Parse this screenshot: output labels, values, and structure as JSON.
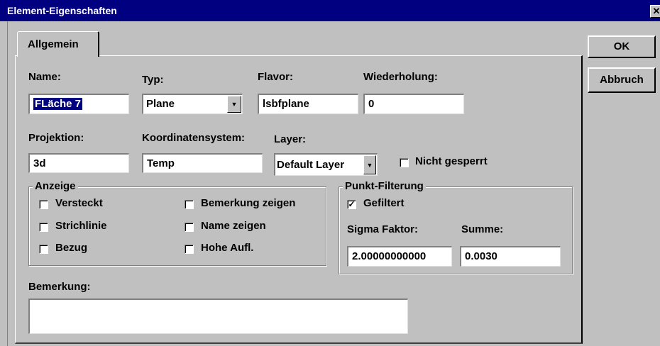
{
  "window": {
    "title": "Element-Eigenschaften",
    "close_glyph": "✕"
  },
  "tabs": [
    {
      "label": "Allgemein"
    }
  ],
  "buttons": {
    "ok": "OK",
    "cancel": "Abbruch"
  },
  "fields": {
    "name": {
      "label": "Name:",
      "value": "FLäche 7"
    },
    "typ": {
      "label": "Typ:",
      "value": "Plane"
    },
    "flavor": {
      "label": "Flavor:",
      "value": "lsbfplane"
    },
    "wiederholung": {
      "label": "Wiederholung:",
      "value": "0"
    },
    "projektion": {
      "label": "Projektion:",
      "value": "3d"
    },
    "koordinatensystem": {
      "label": "Koordinatensystem:",
      "value": "Temp"
    },
    "layer": {
      "label": "Layer:",
      "value": "Default Layer"
    },
    "nicht_gesperrt": {
      "label": "Nicht gesperrt",
      "checked": false
    },
    "bemerkung": {
      "label": "Bemerkung:",
      "value": ""
    }
  },
  "anzeige": {
    "title": "Anzeige",
    "checkboxes": [
      {
        "label": "Versteckt",
        "checked": false
      },
      {
        "label": "Strichlinie",
        "checked": false
      },
      {
        "label": "Bezug",
        "checked": false
      },
      {
        "label": "Bemerkung zeigen",
        "checked": false
      },
      {
        "label": "Name zeigen",
        "checked": false
      },
      {
        "label": "Hohe Aufl.",
        "checked": false
      }
    ]
  },
  "punkt_filterung": {
    "title": "Punkt-Filterung",
    "gefiltert": {
      "label": "Gefiltert",
      "checked": true
    },
    "sigma": {
      "label": "Sigma Faktor:",
      "value": "2.00000000000"
    },
    "summe": {
      "label": "Summe:",
      "value": "0.0030"
    }
  },
  "glyphs": {
    "check": "✓",
    "dropdown_arrow": "▼"
  },
  "colors": {
    "titlebar": "#000080",
    "face": "#c0c0c0",
    "selection": "#000080"
  }
}
